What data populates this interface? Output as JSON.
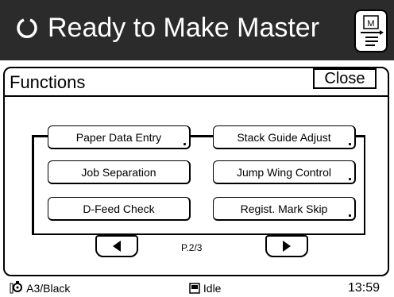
{
  "header": {
    "status_icon": "circular-arrow-icon",
    "title": "Ready to Make Master",
    "master_button_icon": "master-document-icon",
    "master_button_letter": "M"
  },
  "panel": {
    "title": "Functions",
    "close_label": "Close"
  },
  "functions": [
    {
      "label": "Paper Data Entry",
      "has_submenu": true
    },
    {
      "label": "Stack Guide Adjust",
      "has_submenu": true
    },
    {
      "label": "Job Separation",
      "has_submenu": false
    },
    {
      "label": "Jump Wing Control",
      "has_submenu": true
    },
    {
      "label": "D-Feed Check",
      "has_submenu": false
    },
    {
      "label": "Regist. Mark Skip",
      "has_submenu": true
    }
  ],
  "pagination": {
    "prev_icon": "left-triangle-icon",
    "next_icon": "right-triangle-icon",
    "page": "P.2/3"
  },
  "status_bar": {
    "drum_icon": "drum-icon",
    "drum_label": "A3/Black",
    "machine_icon": "machine-icon",
    "machine_state": "Idle",
    "time": "13:59"
  }
}
